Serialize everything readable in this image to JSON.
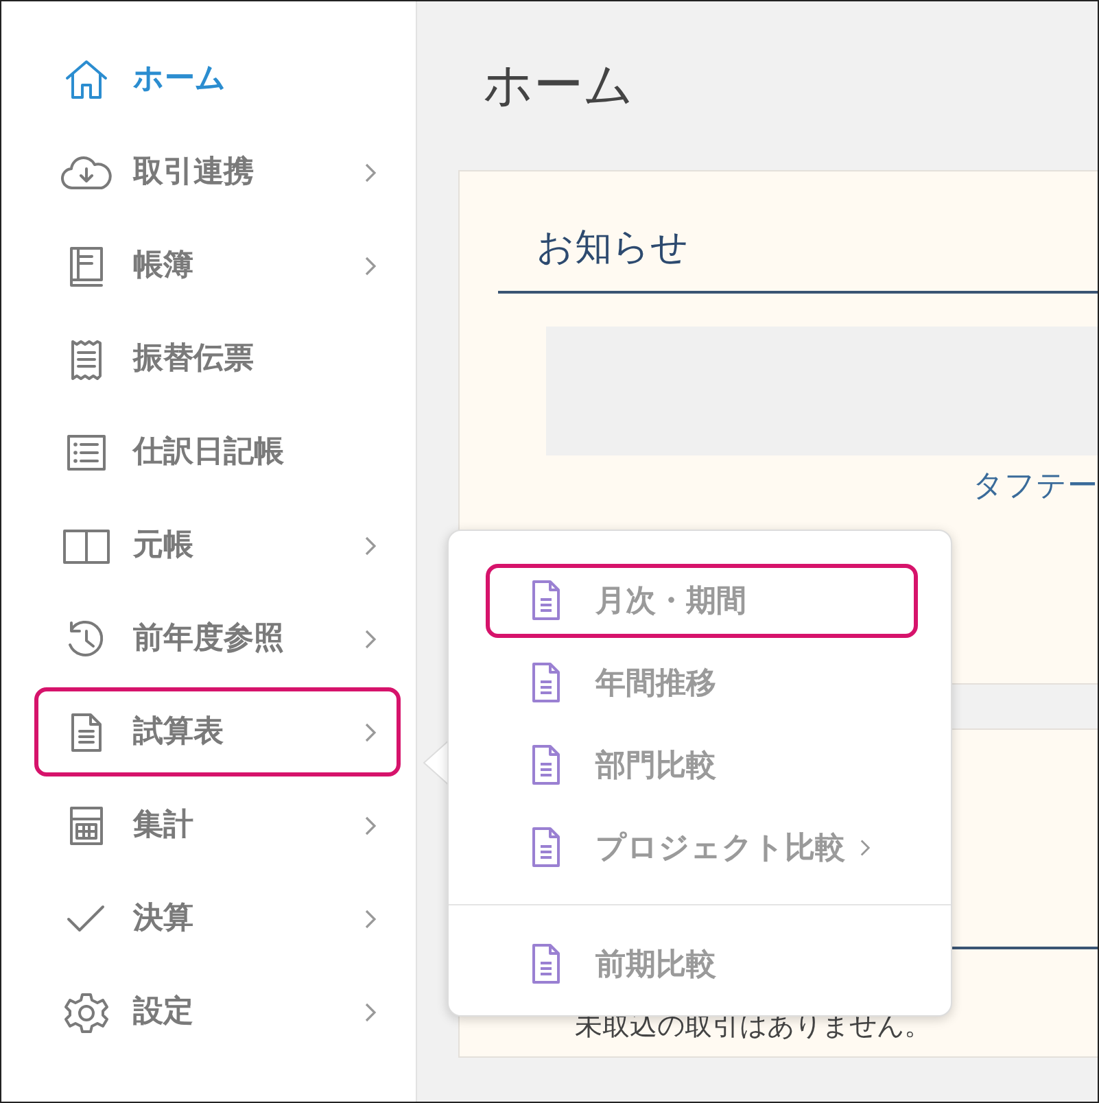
{
  "sidebar": {
    "items": [
      {
        "label": "ホーム",
        "selected": true,
        "has_submenu": false,
        "highlighted": false
      },
      {
        "label": "取引連携",
        "selected": false,
        "has_submenu": true,
        "highlighted": false
      },
      {
        "label": "帳簿",
        "selected": false,
        "has_submenu": true,
        "highlighted": false
      },
      {
        "label": "振替伝票",
        "selected": false,
        "has_submenu": false,
        "highlighted": false
      },
      {
        "label": "仕訳日記帳",
        "selected": false,
        "has_submenu": false,
        "highlighted": false
      },
      {
        "label": "元帳",
        "selected": false,
        "has_submenu": true,
        "highlighted": false
      },
      {
        "label": "前年度参照",
        "selected": false,
        "has_submenu": true,
        "highlighted": false
      },
      {
        "label": "試算表",
        "selected": false,
        "has_submenu": true,
        "highlighted": true
      },
      {
        "label": "集計",
        "selected": false,
        "has_submenu": true,
        "highlighted": false
      },
      {
        "label": "決算",
        "selected": false,
        "has_submenu": true,
        "highlighted": false
      },
      {
        "label": "設定",
        "selected": false,
        "has_submenu": true,
        "highlighted": false
      }
    ]
  },
  "page_title": "ホーム",
  "notice_card": {
    "title": "お知らせ",
    "link_text": "タフテー"
  },
  "submenu": {
    "sections": [
      {
        "items": [
          {
            "label": "月次・期間",
            "highlighted": true,
            "has_submenu": false
          },
          {
            "label": "年間推移",
            "highlighted": false,
            "has_submenu": false
          },
          {
            "label": "部門比較",
            "highlighted": false,
            "has_submenu": false
          },
          {
            "label": "プロジェクト比較",
            "highlighted": false,
            "has_submenu": true
          }
        ]
      },
      {
        "items": [
          {
            "label": "前期比較",
            "highlighted": false,
            "has_submenu": false
          }
        ]
      }
    ]
  },
  "import_card": {
    "message": "未取込の取引はありません。"
  }
}
